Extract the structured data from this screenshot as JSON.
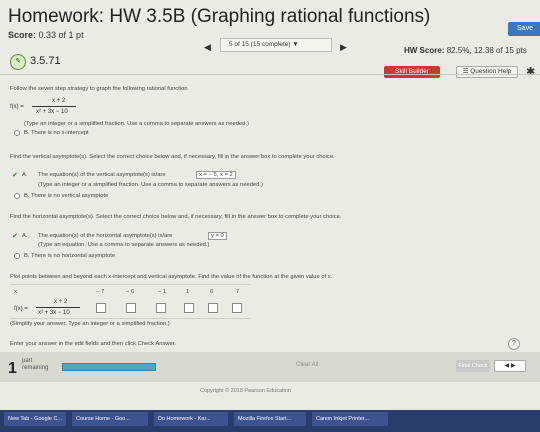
{
  "header": {
    "title": "Homework: HW 3.5B (Graphing rational functions)",
    "save_label": "Save",
    "score_label": "Score:",
    "score_value": "0.33 of 1 pt",
    "nav_text": "5 of 15 (15 complete) ▼",
    "hw_score_label": "HW Score:",
    "hw_score_value": "82.5%, 12.38 of 15 pts"
  },
  "question": {
    "badge": "✎",
    "number": "3.5.71",
    "skill_builder": "Skill Builder",
    "question_help": "Question Help",
    "instruction": "Follow the seven step strategy to graph the following rational function",
    "f_label": "f(x) =",
    "numerator": "x + 2",
    "denominator": "x² + 3x − 10",
    "xint_note": "(Type an integer or a simplified fraction. Use a comma to separate answers as needed.)",
    "xint_b": "B.   There is no x-intercept"
  },
  "vertical": {
    "prompt": "Find the vertical asymptote(s). Select the correct choice below and, if necessary, fill in the answer box to complete your choice.",
    "a_label": "A.",
    "a_text": "The equation(s) of the vertical asymptote(s) is/are",
    "a_answer": "x = − 5, x = 2",
    "a_note": "(Type an integer or a simplified fraction. Use a comma to separate answers as needed.)",
    "b_text": "B.   There is no vertical asymptote"
  },
  "horizontal": {
    "prompt": "Find the horizontal asymptote(s). Select the correct choice below and, if necessary, fill in the answer box to complete your choice.",
    "a_label": "A.",
    "a_text": "The equation(s) of the horizontal asymptote(s) is/are",
    "a_answer": "y = 0",
    "a_note": "(Type an equation. Use a comma to separate answers as needed.)",
    "b_text": "B.   There is no horizontal asymptote"
  },
  "plot": {
    "prompt": "Plot points between and beyond each x-intercept and vertical asymptote. Find the value of the function at the given value of x.",
    "x_label": "x",
    "x_values": [
      "− 7",
      "− 6",
      "− 1",
      "1",
      "6",
      "7"
    ],
    "fx_label": "f(x) =",
    "numerator": "x + 2",
    "denominator": "x² + 3x − 10",
    "note": "(Simplify your answer. Type an integer or a simplified fraction.)"
  },
  "footer": {
    "enter_answer": "Enter your answer in the edit fields and then click Check Answer.",
    "help": "?",
    "part_num": "1",
    "part_label_1": "part",
    "part_label_2": "remaining",
    "clear_all": "Clear All",
    "final_check": "Final Check",
    "nav_arrows": "◀  ▶",
    "copyright": "Copyright © 2018 Pearson Education"
  },
  "taskbar": [
    "New Tab - Google C...",
    "Course Home - Goo...",
    "Do Homework - Kar...",
    "Mozilla Firefox Start...",
    "Canon Inkjet Printer..."
  ]
}
